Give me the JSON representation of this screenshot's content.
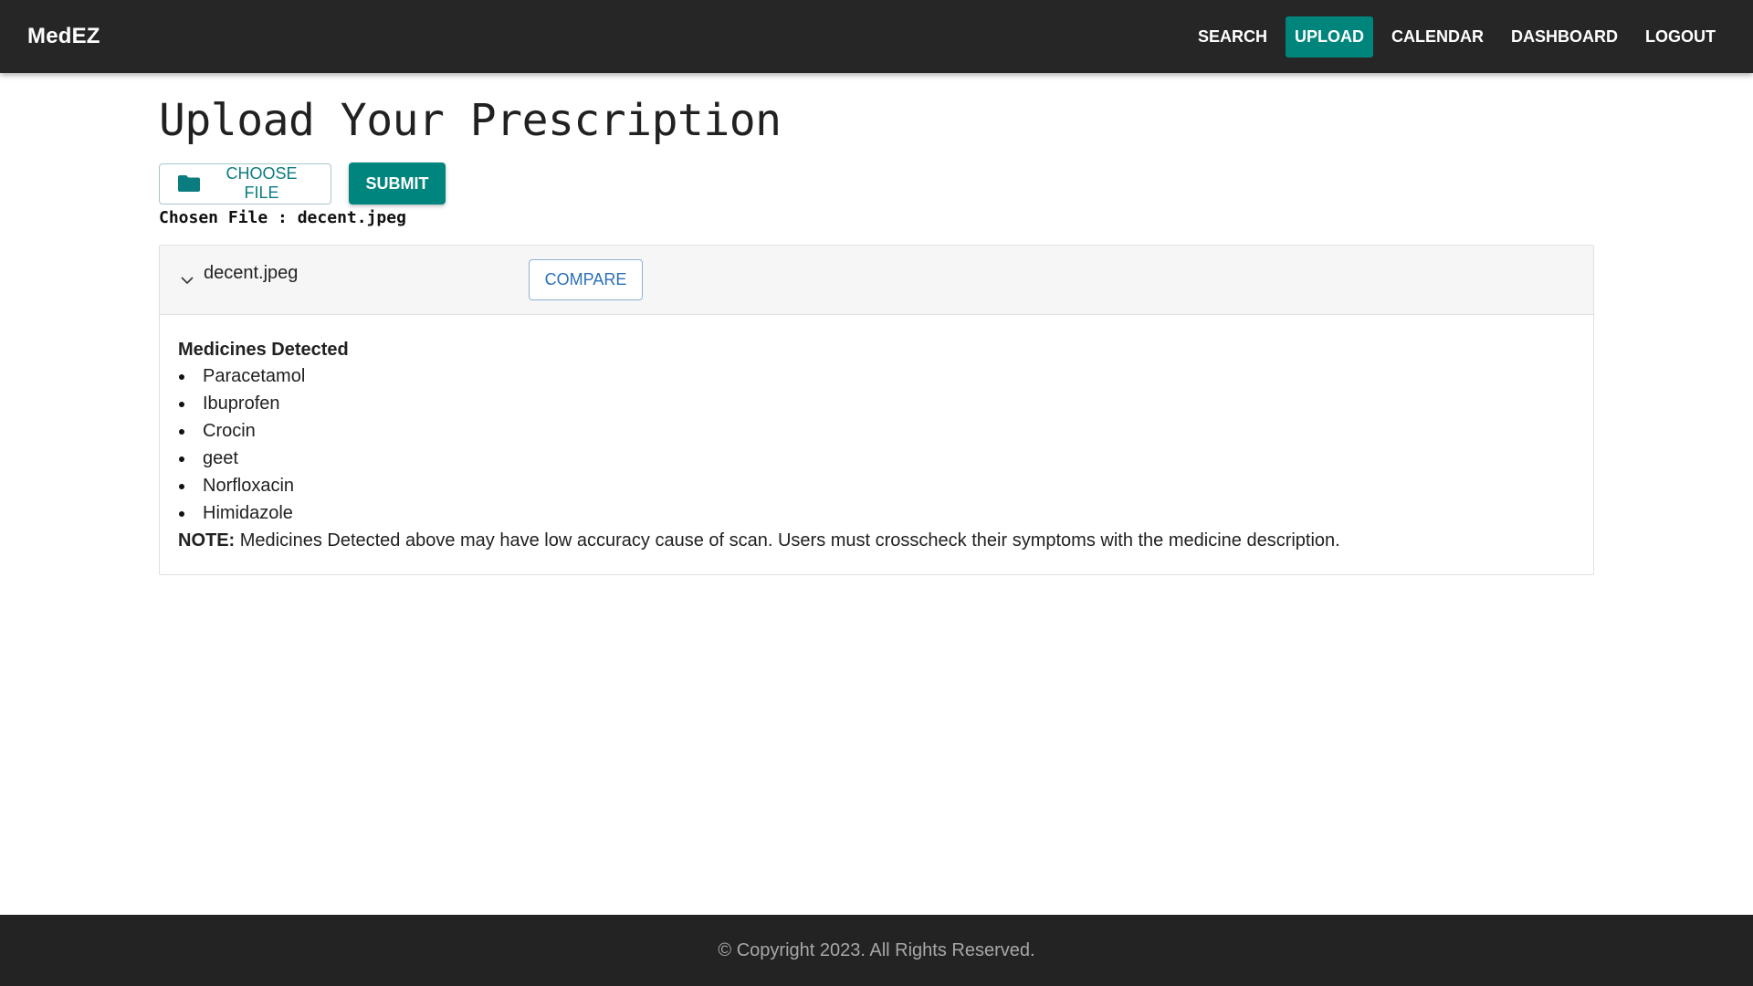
{
  "brand": "MedEZ",
  "nav": {
    "items": [
      {
        "label": "SEARCH",
        "active": false
      },
      {
        "label": "UPLOAD",
        "active": true
      },
      {
        "label": "CALENDAR",
        "active": false
      },
      {
        "label": "DASHBOARD",
        "active": false
      },
      {
        "label": "LOGOUT",
        "active": false
      }
    ]
  },
  "page": {
    "title": "Upload Your Prescription",
    "choose_file_label": "CHOOSE FILE",
    "submit_label": "SUBMIT",
    "chosen_file_text": "Chosen File : decent.jpeg"
  },
  "panel": {
    "file_name": "decent.jpeg",
    "compare_label": "COMPARE",
    "heading": "Medicines Detected",
    "medicines": [
      "Paracetamol",
      "Ibuprofen",
      "Crocin",
      "geet",
      "Norfloxacin",
      "Himidazole"
    ],
    "note_label": "NOTE:",
    "note_text": " Medicines Detected above may have low accuracy cause of scan. Users must crosscheck their symptoms with the medicine description."
  },
  "footer": {
    "copyright": "© Copyright 2023. All Rights Reserved."
  },
  "colors": {
    "navbar_bg": "#262626",
    "accent": "#00857c",
    "footer_bg": "#232323",
    "compare_text": "#2a70b8"
  },
  "icons": {
    "choose_file": "folder-icon",
    "expand": "chevron-down-icon"
  }
}
